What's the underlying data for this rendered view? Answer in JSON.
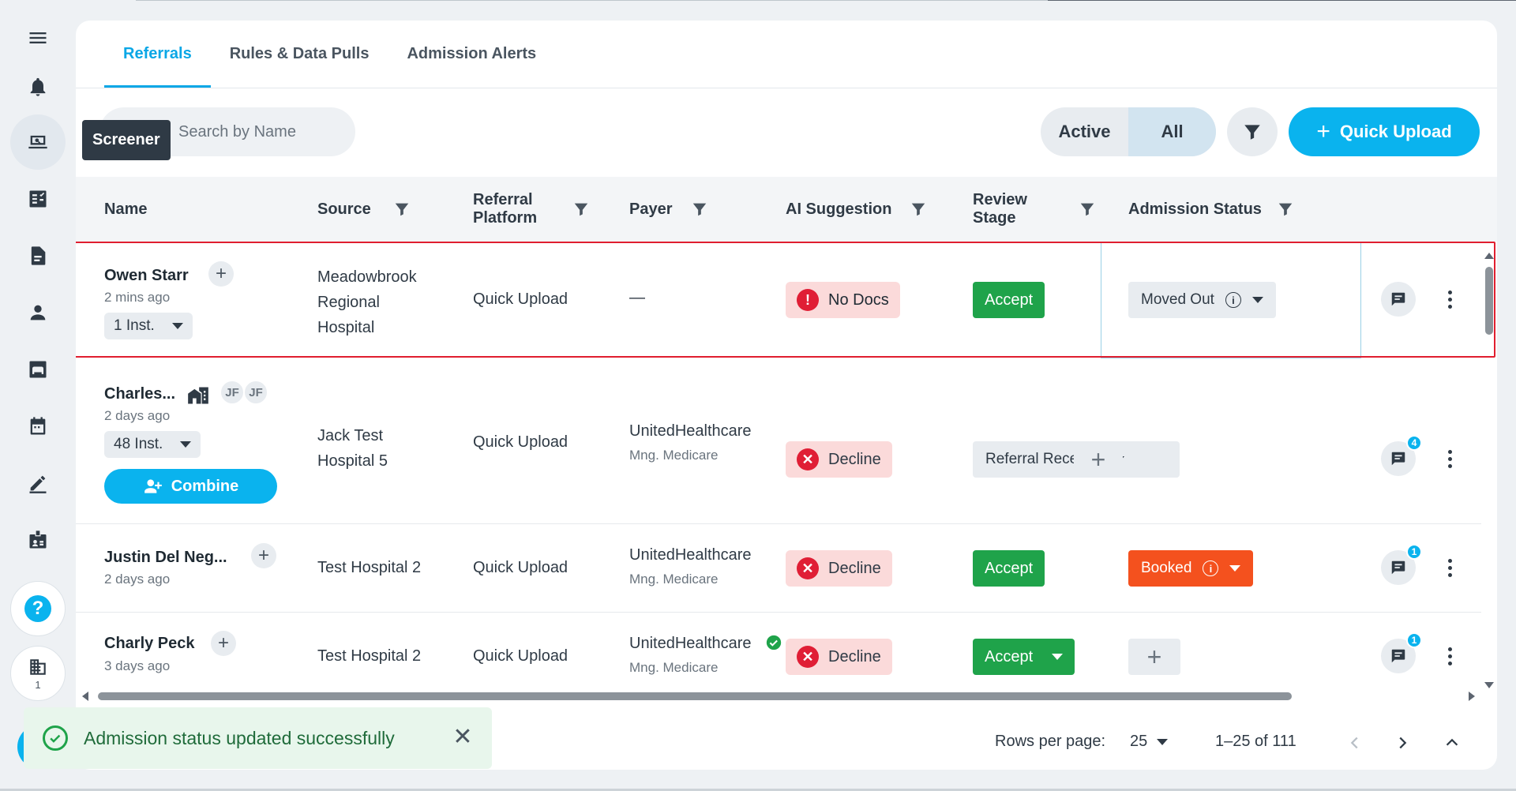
{
  "sidebar": {
    "items": [
      {
        "icon": "menu-icon"
      },
      {
        "icon": "bell-icon"
      },
      {
        "icon": "screener-icon",
        "active": true
      },
      {
        "icon": "checklist-icon"
      },
      {
        "icon": "document-icon"
      },
      {
        "icon": "person-icon"
      },
      {
        "icon": "bed-icon"
      },
      {
        "icon": "calendar-icon"
      },
      {
        "icon": "pen-icon"
      },
      {
        "icon": "badge-icon"
      }
    ],
    "help_icon": "?",
    "building_count": "1",
    "tooltip": "Screener"
  },
  "tabs": [
    "Referrals",
    "Rules & Data Pulls",
    "Admission Alerts"
  ],
  "search": {
    "placeholder": "Search by Name"
  },
  "toggle": {
    "active": "Active",
    "all": "All",
    "selected": "All"
  },
  "quick_upload": "Quick Upload",
  "columns": [
    "Name",
    "Source",
    "Referral Platform",
    "Payer",
    "AI Suggestion",
    "Review Stage",
    "Admission Status"
  ],
  "rows": [
    {
      "name": "Owen Starr",
      "ago": "2 mins ago",
      "inst": "1 Inst.",
      "source": "Meadowbrook Regional Hospital",
      "platform": "Quick Upload",
      "payer": "—",
      "payer_sub": "",
      "ai": "No Docs",
      "review": "Accept",
      "status": "Moved Out"
    },
    {
      "name": "Charles...",
      "ago": "2 days ago",
      "inst": "48 Inst.",
      "avatars": [
        "JF",
        "JF"
      ],
      "combine": "Combine",
      "source": "Jack Test Hospital 5",
      "platform": "Quick Upload",
      "payer": "UnitedHealthcare",
      "payer_sub": "Mng. Medicare",
      "ai": "Decline",
      "review": "Referral Received",
      "status": "",
      "comments": "4"
    },
    {
      "name": "Justin Del Neg...",
      "ago": "2 days ago",
      "source": "Test Hospital 2",
      "platform": "Quick Upload",
      "payer": "UnitedHealthcare",
      "payer_sub": "Mng. Medicare",
      "ai": "Decline",
      "review": "Accept",
      "status": "Booked",
      "comments": "1"
    },
    {
      "name": "Charly Peck",
      "ago": "3 days ago",
      "source": "Test Hospital 2",
      "platform": "Quick Upload",
      "payer": "UnitedHealthcare",
      "payer_sub": "Mng. Medicare",
      "ai": "Decline",
      "review": "Accept",
      "status": "",
      "comments": "1"
    }
  ],
  "pagination": {
    "rows_label": "Rows per page:",
    "rows_value": "25",
    "range": "1–25 of 111"
  },
  "toast": {
    "message": "Admission status updated successfully"
  },
  "colors": {
    "accent": "#0ab3ee",
    "accept": "#1fa34a",
    "booked": "#f4511e",
    "decline_bg": "#fbdada",
    "error": "#e01e35"
  }
}
